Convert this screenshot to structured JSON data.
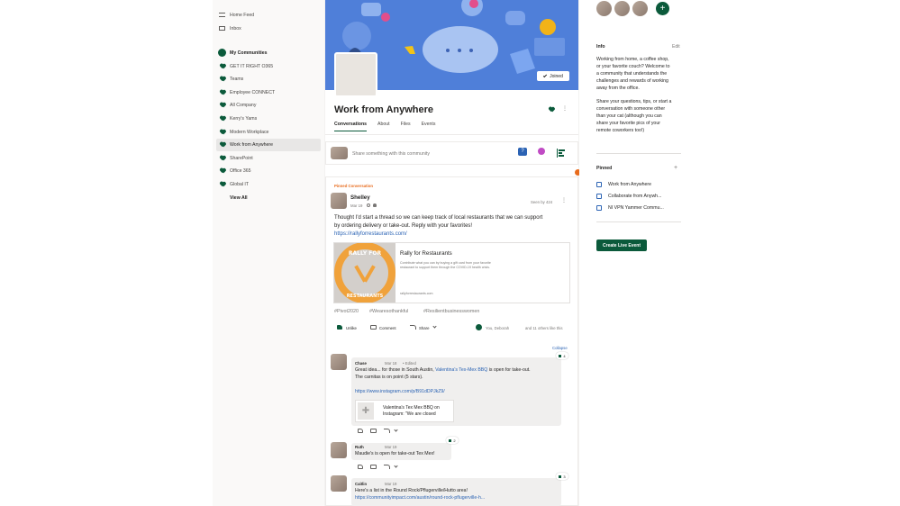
{
  "nav": {
    "home_feed": "Home Feed",
    "inbox": "Inbox",
    "my_communities": "My Communities",
    "communities": [
      "GET IT RIGHT O365",
      "Teams",
      "Employee CONNECT",
      "All Company",
      "Kerry's Yams",
      "Modern Workplace",
      "Work from Anywhere",
      "SharePoint",
      "Office 365",
      "Global IT"
    ],
    "view_all": "View All"
  },
  "community": {
    "joined_label": "Joined",
    "title": "Work from Anywhere",
    "tabs": [
      "Conversations",
      "About",
      "Files",
      "Events"
    ]
  },
  "composer": {
    "placeholder": "Share something with this community"
  },
  "pinned_label": "Pinned Conversation",
  "post": {
    "author": "Shelley",
    "date": "Mar 19",
    "seen": "Seen by 424",
    "body_line1": "Thought I'd start a thread so we can keep track of local restaurants that we can support",
    "body_line2": "by ordering delivery or take-out.  Reply with your favorites!",
    "link": "https://rallyforrestaurants.com/",
    "preview": {
      "title": "Rally for Restaurants",
      "desc_line1": "Contribute what you can by buying a gift card from your favorite",
      "desc_line2": "restaurant to support them through the COVID-19 health crisis.",
      "domain": "rallyforrestaurants.com",
      "logo_top": "RALLY FOR",
      "logo_bottom": "RESTAURANTS"
    },
    "hashtags": [
      "#Pivot2020",
      "#Wearesothankful",
      "#Resilientbusinesswomen"
    ],
    "actions": {
      "unlike": "Unlike",
      "comment": "Comment",
      "share": "Share"
    },
    "likes_you": "You, Deborah",
    "likes_others": "and 11 others like this",
    "collapse": "Collapse"
  },
  "comments": [
    {
      "author": "Chase",
      "date": "Mar 18",
      "edited": "Edited",
      "line1_pre": "Great idea... for those in South Austin,",
      "line1_link": "Valentina's Tex-Mex BBQ",
      "line1_post": "is open for take-out.",
      "line2": "The carnitas is on point (5 stars).",
      "link": "https://www.instagram.com/p/B91dDPJkZ9/",
      "embed_line1": "Valentina's Tex Mex BBQ on",
      "embed_line2": "Instagram: \"We are closed",
      "likes": "4"
    },
    {
      "author": "Ruth",
      "date": "Mar 19",
      "line1": "Maudie's is open for take-out Tex Mex!",
      "likes": "2"
    },
    {
      "author": "Caitlin",
      "date": "Mar 19",
      "line1": "Here's a list in the Round Rock/Pflugerville/Hutto area!",
      "link": "https://communityimpact.com/austin/round-rock-pflugerville-h...",
      "likes": "3"
    }
  ],
  "info": {
    "heading": "Info",
    "edit": "Edit",
    "p1": [
      "Working from home, a coffee shop,",
      "or your favorite couch? Welcome to",
      "a community that understands the",
      "challenges and rewards of working",
      "away from the office."
    ],
    "p2": [
      "Share your questions, tips, or start a",
      "conversation with someone other",
      "than your cat (although you can",
      "share your favorite pics of your",
      "remote coworkers too!)"
    ]
  },
  "pinned": {
    "heading": "Pinned",
    "items": [
      "Work from Anywhere",
      "Collaborate from Anywh...",
      "NI VPN Yammer Commu..."
    ]
  },
  "live_event": "Create Live Event",
  "colors": {
    "brand": "#0b5a3b",
    "link": "#2b63b4",
    "banner": "#4f7fd9",
    "accent": "#e86b1c"
  }
}
